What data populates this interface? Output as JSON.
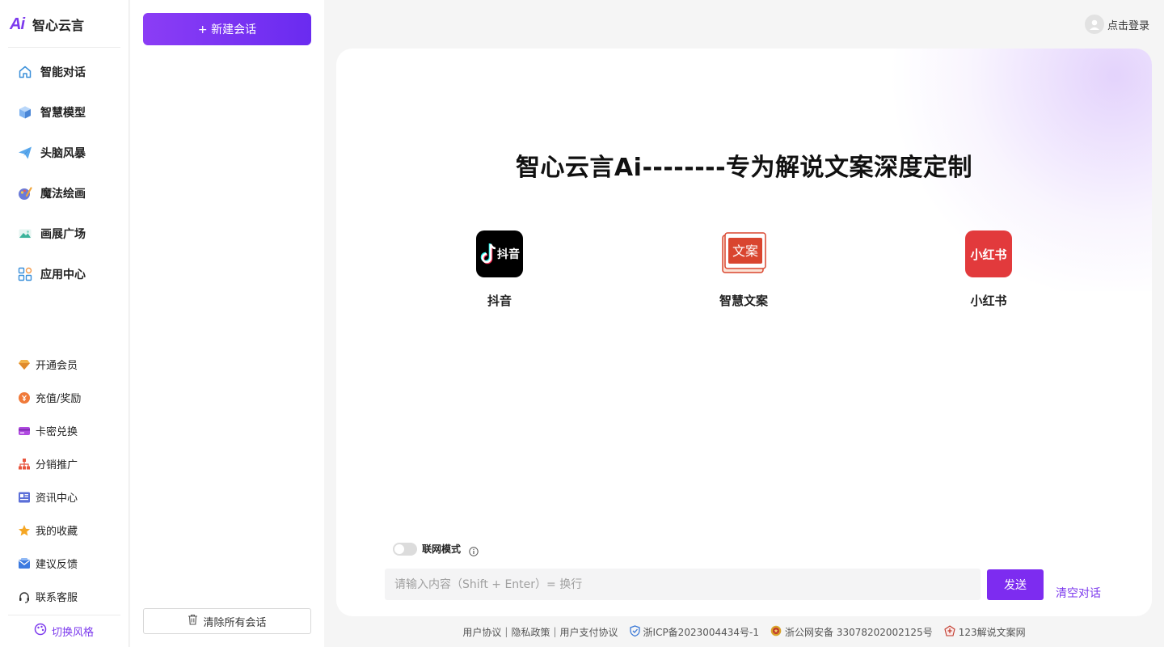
{
  "brand": {
    "logo_mark": "Ai",
    "name": "智心云言"
  },
  "nav": [
    {
      "label": "智能对话",
      "icon": "home-icon"
    },
    {
      "label": "智慧模型",
      "icon": "cube-icon"
    },
    {
      "label": "头脑风暴",
      "icon": "paper-plane-icon"
    },
    {
      "label": "魔法绘画",
      "icon": "palette-icon"
    },
    {
      "label": "画展广场",
      "icon": "landscape-icon"
    },
    {
      "label": "应用中心",
      "icon": "apps-grid-icon"
    }
  ],
  "tools": [
    {
      "label": "开通会员",
      "icon": "diamond-icon"
    },
    {
      "label": "充值/奖励",
      "icon": "coin-icon"
    },
    {
      "label": "卡密兑换",
      "icon": "card-icon"
    },
    {
      "label": "分销推广",
      "icon": "org-chart-icon"
    },
    {
      "label": "资讯中心",
      "icon": "news-icon"
    },
    {
      "label": "我的收藏",
      "icon": "star-icon"
    },
    {
      "label": "建议反馈",
      "icon": "mail-icon"
    },
    {
      "label": "联系客服",
      "icon": "headset-icon"
    }
  ],
  "style_switch": {
    "label": "切换风格"
  },
  "conversations": {
    "new_chat_label": "+ 新建会话",
    "clear_all_label": "清除所有会话"
  },
  "header": {
    "login_label": "点击登录"
  },
  "main": {
    "title": "智心云言Ai--------专为解说文案深度定制",
    "apps": [
      {
        "name": "抖音",
        "tile_text": "抖音",
        "color": "#000000"
      },
      {
        "name": "智慧文案",
        "tile_text": "文案",
        "color": "#d9452f"
      },
      {
        "name": "小红书",
        "tile_text": "小红书",
        "color": "#e23a3c"
      }
    ],
    "net_mode_label": "联网模式",
    "input_placeholder": "请输入内容（Shift + Enter）= 换行",
    "send_label": "发送",
    "clear_conv_label": "清空对话"
  },
  "footer": {
    "links": [
      "用户协议",
      "隐私政策",
      "用户支付协议"
    ],
    "icp": "浙ICP备2023004434号-1",
    "police": "浙公网安备 33078202002125号",
    "site": "123解说文案网"
  },
  "colors": {
    "accent": "#7c3aed",
    "send": "#7d2cf0"
  }
}
